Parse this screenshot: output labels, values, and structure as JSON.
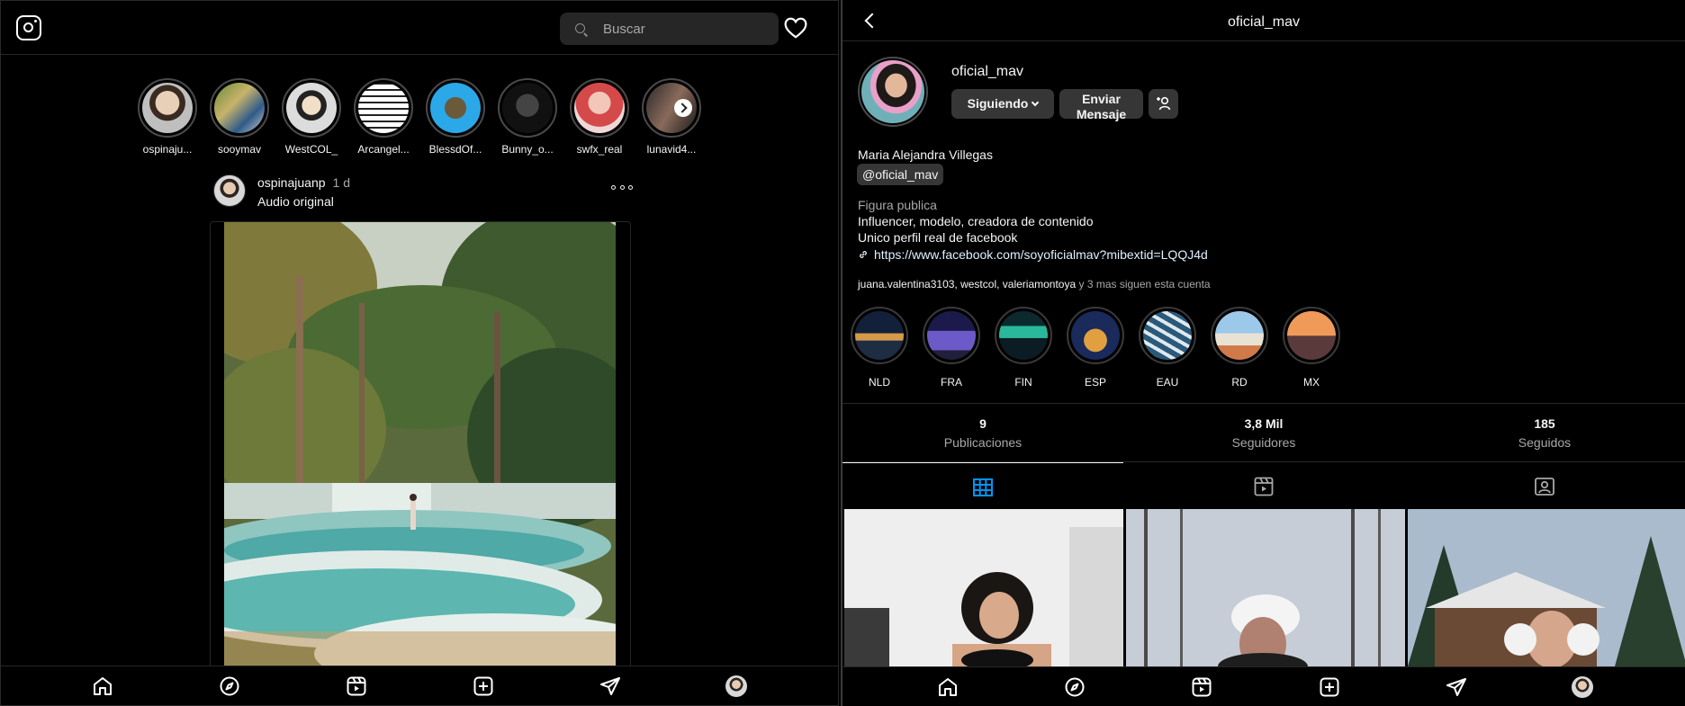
{
  "feed": {
    "search": {
      "placeholder": "Buscar"
    },
    "stories": [
      {
        "name": "ospinaju..."
      },
      {
        "name": "sooymav"
      },
      {
        "name": "WestCOL_"
      },
      {
        "name": "Arcangel..."
      },
      {
        "name": "BlessdOf..."
      },
      {
        "name": "Bunny_o..."
      },
      {
        "name": "swfx_real"
      },
      {
        "name": "lunavid4..."
      }
    ],
    "post": {
      "username": "ospinajuanp",
      "time": "1 d",
      "subtitle": "Audio original"
    }
  },
  "profile": {
    "title": "oficial_mav",
    "username": "oficial_mav",
    "follow_label": "Siguiendo",
    "message_line1": "Enviar",
    "message_line2": "Mensaje",
    "full_name": "Maria Alejandra Villegas",
    "handle": "@oficial_mav",
    "category": "Figura publica",
    "bio_line1": "Influencer, modelo, creadora de contenido",
    "bio_line2": "Unico perfil real de facebook",
    "link": "https://www.facebook.com/soyoficialmav?mibextid=LQQJ4d",
    "followed_by_names": "juana.valentina3103, westcol, valeriamontoya",
    "followed_by_more": " y 3 mas siguen esta cuenta",
    "highlights": [
      {
        "label": "NLD"
      },
      {
        "label": "FRA"
      },
      {
        "label": "FIN"
      },
      {
        "label": "ESP"
      },
      {
        "label": "EAU"
      },
      {
        "label": "RD"
      },
      {
        "label": "MX"
      }
    ],
    "stats": [
      {
        "value": "9",
        "label": "Publicaciones"
      },
      {
        "value": "3,8 Mil",
        "label": "Seguidores"
      },
      {
        "value": "185",
        "label": "Seguidos"
      }
    ]
  },
  "nav_icons": [
    "home-icon",
    "explore-icon",
    "reels-icon",
    "create-icon",
    "direct-icon",
    "profile-avatar"
  ],
  "colors": {
    "background": "#000000",
    "accent": "#0095f6",
    "surface": "#262626",
    "button": "#363636"
  }
}
